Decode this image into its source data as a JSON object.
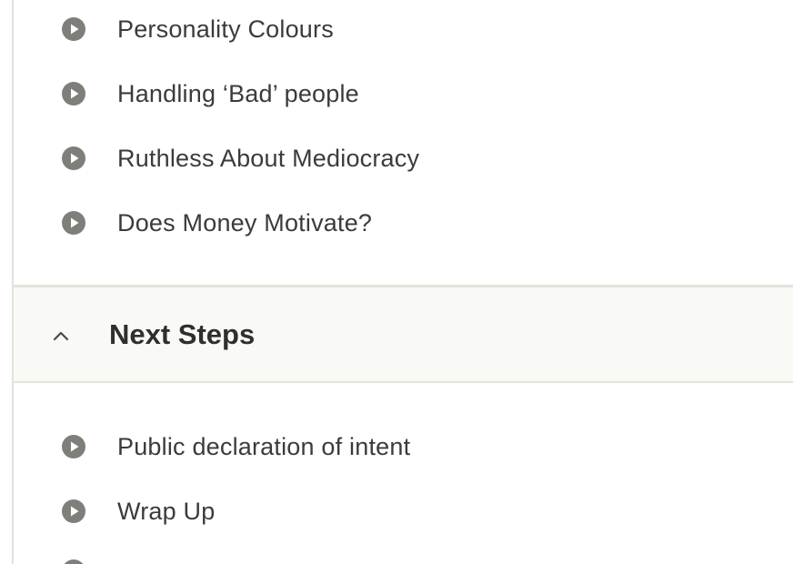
{
  "modules_before": [
    {
      "label": "Personality Colours",
      "icon": "play-circle-icon"
    },
    {
      "label": "Handling ‘Bad’ people",
      "icon": "play-circle-icon"
    },
    {
      "label": "Ruthless About Mediocracy",
      "icon": "play-circle-icon"
    },
    {
      "label": "Does Money Motivate?",
      "icon": "play-circle-icon"
    }
  ],
  "section": {
    "title": "Next Steps",
    "toggle_icon": "chevron-up-icon",
    "expanded": true
  },
  "modules_after": [
    {
      "label": "Public declaration of intent",
      "icon": "play-circle-icon"
    },
    {
      "label": "Wrap Up",
      "icon": "play-circle-icon"
    }
  ],
  "colors": {
    "icon": "#7f7f7a",
    "text": "#3b3b3b",
    "section_bg": "#f9f9f5",
    "border": "#e3e3da"
  }
}
